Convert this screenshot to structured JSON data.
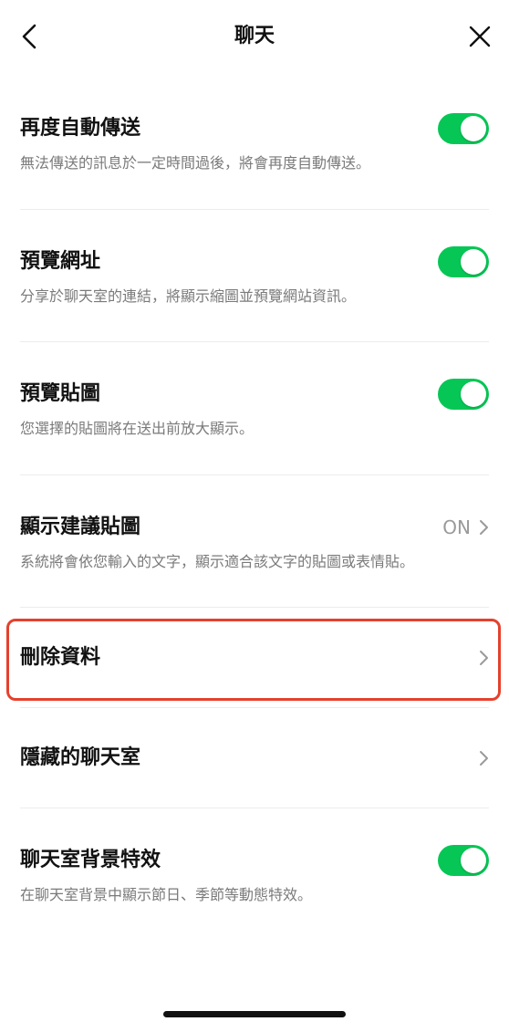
{
  "header": {
    "title": "聊天"
  },
  "settings": [
    {
      "title": "再度自動傳送",
      "desc": "無法傳送的訊息於一定時間過後，將會再度自動傳送。",
      "control": "toggle",
      "on": true
    },
    {
      "title": "預覽網址",
      "desc": "分享於聊天室的連結，將顯示縮圖並預覽網站資訊。",
      "control": "toggle",
      "on": true
    },
    {
      "title": "預覽貼圖",
      "desc": "您選擇的貼圖將在送出前放大顯示。",
      "control": "toggle",
      "on": true
    },
    {
      "title": "顯示建議貼圖",
      "desc": "系統將會依您輸入的文字，顯示適合該文字的貼圖或表情貼。",
      "control": "value",
      "value": "ON"
    },
    {
      "title": "刪除資料",
      "control": "chevron"
    },
    {
      "title": "隱藏的聊天室",
      "control": "chevron"
    },
    {
      "title": "聊天室背景特效",
      "desc": "在聊天室背景中顯示節日、季節等動態特效。",
      "control": "toggle",
      "on": true
    }
  ],
  "colors": {
    "accent": "#06c755",
    "highlight": "#e5412d",
    "desc_text": "#7a7a7a"
  },
  "icons": {
    "back": "chevron-left-icon",
    "close": "close-icon",
    "row_arrow": "chevron-right-icon"
  }
}
